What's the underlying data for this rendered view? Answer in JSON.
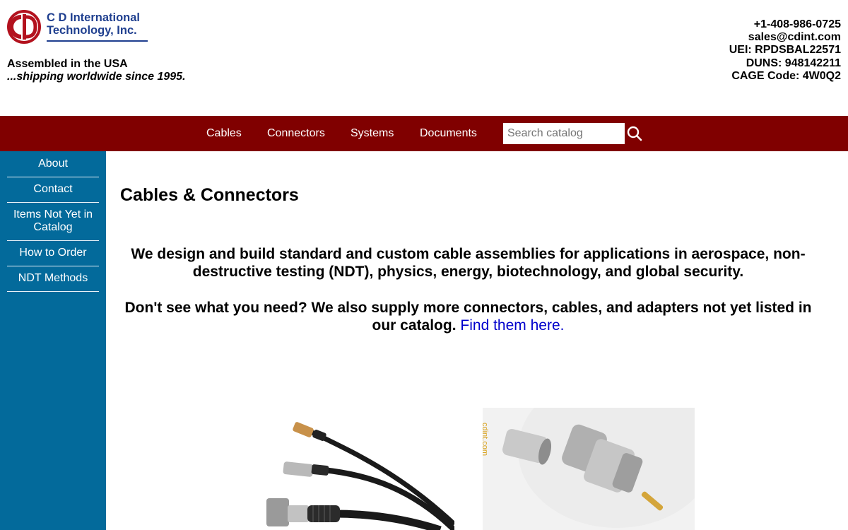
{
  "header": {
    "company_line1": "C D International",
    "company_line2": "Technology, Inc.",
    "tagline_line1": "Assembled in the USA",
    "tagline_line2": "...shipping worldwide since 1995.",
    "contact": {
      "phone": "+1-408-986-0725",
      "email": "sales@cdint.com",
      "uei": "UEI: RPDSBAL22571",
      "duns": "DUNS: 948142211",
      "cage": "CAGE Code: 4W0Q2"
    },
    "brand_color": "#1f3f8f",
    "logo_color": "#b3121e"
  },
  "nav": {
    "background": "#800000",
    "items": [
      {
        "label": "Cables"
      },
      {
        "label": "Connectors"
      },
      {
        "label": "Systems"
      },
      {
        "label": "Documents"
      }
    ],
    "search_placeholder": "Search catalog",
    "search_icon": "search-icon"
  },
  "sidebar": {
    "background": "#036a9b",
    "items": [
      {
        "label": "About"
      },
      {
        "label": "Contact"
      },
      {
        "label": "Items Not Yet in Catalog"
      },
      {
        "label": "How to Order"
      },
      {
        "label": "NDT Methods"
      }
    ]
  },
  "main": {
    "title": "Cables & Connectors",
    "intro": "We design and build standard and custom cable assemblies for applications in aerospace, non-destructive testing (NDT), physics, energy, biotechnology, and global security.",
    "intro2_text": "Don't see what you need? We also supply more connectors, cables, and adapters not yet listed in our catalog.",
    "intro2_link": "Find them here.",
    "link_color": "#0000cc",
    "image2_watermark": "cdint.com"
  }
}
